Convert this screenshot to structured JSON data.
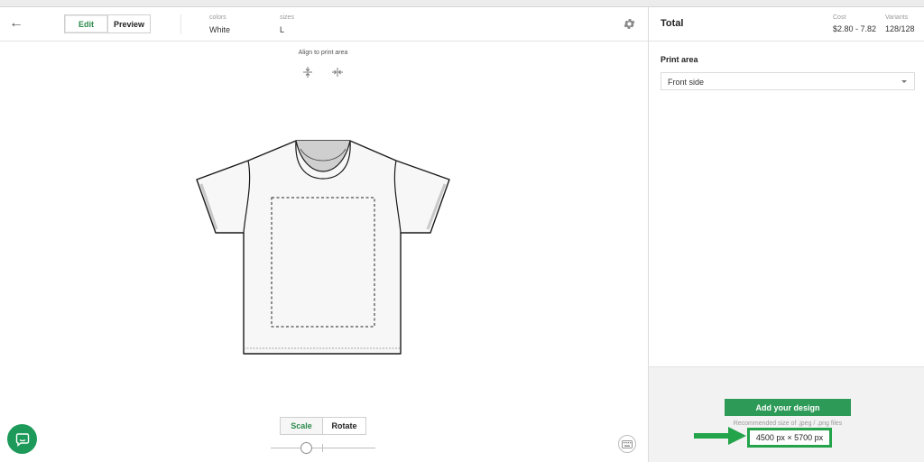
{
  "toolbar": {
    "edit_label": "Edit",
    "preview_label": "Preview",
    "colors_label": "colors",
    "colors_value": "White",
    "sizes_label": "sizes",
    "sizes_value": "L"
  },
  "canvas": {
    "align_label": "Align to print area",
    "scale_label": "Scale",
    "rotate_label": "Rotate"
  },
  "panel": {
    "title": "Total",
    "cost_label": "Cost",
    "cost_value": "$2.80 - 7.82",
    "variants_label": "Variants",
    "variants_value": "128/128",
    "print_area_label": "Print area",
    "print_area_selected": "Front side",
    "add_design_label": "Add your design",
    "recommended_text": "Recommended size of .jpeg / .png files",
    "dimensions_text": "4500 px × 5700 px"
  },
  "colors": {
    "accent_green": "#2e9a57",
    "highlight_green": "#23a34a"
  }
}
